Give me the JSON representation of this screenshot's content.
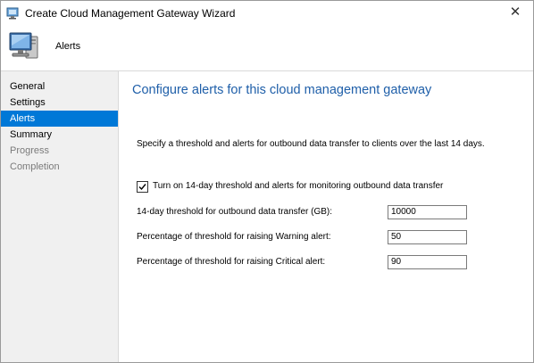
{
  "window": {
    "title": "Create Cloud Management Gateway Wizard",
    "close_glyph": "✕",
    "title_icon": "wizard-app-icon"
  },
  "header": {
    "title": "Alerts",
    "icon": "computer-monitor-icon"
  },
  "sidebar": {
    "items": [
      {
        "label": "General",
        "state": "normal"
      },
      {
        "label": "Settings",
        "state": "normal"
      },
      {
        "label": "Alerts",
        "state": "active"
      },
      {
        "label": "Summary",
        "state": "normal"
      },
      {
        "label": "Progress",
        "state": "disabled"
      },
      {
        "label": "Completion",
        "state": "disabled"
      }
    ]
  },
  "main": {
    "title": "Configure alerts for this cloud management gateway",
    "description": "Specify a threshold and alerts for outbound data transfer to clients over the last 14 days.",
    "checkbox": {
      "label": "Turn on 14-day threshold and alerts for monitoring outbound data transfer",
      "checked": true
    },
    "fields": [
      {
        "label": "14-day threshold for outbound data transfer (GB):",
        "value": "10000"
      },
      {
        "label": "Percentage of threshold for raising Warning alert:",
        "value": "50"
      },
      {
        "label": "Percentage of threshold for raising Critical alert:",
        "value": "90"
      }
    ]
  },
  "colors": {
    "accent": "#0078d7",
    "title_blue": "#1f5fa9",
    "sidebar_bg": "#f0f0f0",
    "disabled_text": "#7b7b7b"
  }
}
